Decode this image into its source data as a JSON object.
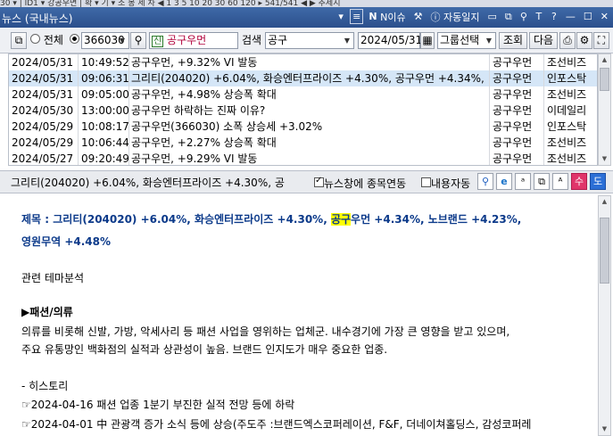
{
  "top_strip": {
    "text": "30 ▾  |  ID1 ▾  강공우면  |  확 ▾  기 ▾  조  봉  세  차  ◀  1  3  5  10 20 30 60 120  ▸   541/541  ◀  ▶  추세지"
  },
  "window": {
    "title": "뉴스 (국내뉴스)",
    "controls": {
      "n_issue_label": "N이슈",
      "auto_log_label": "자동일지"
    }
  },
  "toolbar": {
    "all_label": "전체",
    "stock_code": "366030",
    "stock_name": "공구우먼",
    "search_label": "검색",
    "search_value": "공구",
    "date": "2024/05/31",
    "group_select": "그룹선택",
    "query_button": "조회",
    "next_button": "다음"
  },
  "news": {
    "rows": [
      {
        "date": "2024/05/31",
        "time": "10:49:52",
        "title": "공구우먼, +9.32% VI 발동",
        "code": "공구우먼",
        "source": "조선비즈",
        "selected": false
      },
      {
        "date": "2024/05/31",
        "time": "09:06:31",
        "title": "그리티(204020) +6.04%, 화승엔터프라이즈 +4.30%, 공구우먼 +4.34%,",
        "code": "공구우먼",
        "source": "인포스탁",
        "selected": true
      },
      {
        "date": "2024/05/31",
        "time": "09:05:00",
        "title": "공구우먼, +4.98% 상승폭 확대",
        "code": "공구우먼",
        "source": "조선비즈",
        "selected": false
      },
      {
        "date": "2024/05/30",
        "time": "13:00:00",
        "title": "공구우먼 하락하는 진짜 이유?",
        "code": "공구우먼",
        "source": "이데일리",
        "selected": false
      },
      {
        "date": "2024/05/29",
        "time": "10:08:17",
        "title": "공구우먼(366030) 소폭 상승세 +3.02%",
        "code": "공구우먼",
        "source": "인포스탁",
        "selected": false
      },
      {
        "date": "2024/05/29",
        "time": "10:06:44",
        "title": "공구우먼, +2.27% 상승폭 확대",
        "code": "공구우먼",
        "source": "조선비즈",
        "selected": false
      },
      {
        "date": "2024/05/27",
        "time": "09:20:49",
        "title": "공구우먼, +9.29% VI 발동",
        "code": "공구우먼",
        "source": "조선비즈",
        "selected": false
      }
    ]
  },
  "detail": {
    "title": "그리티(204020)  +6.04%, 화승엔터프라이즈 +4.30%, 공",
    "link_label": "뉴스창에 종목연동",
    "content_label": "내용자동",
    "headline_prefix": "제목 : 그리티(204020) +6.04%, 화승엔터프라이즈 +4.30%, ",
    "headline_highlight": "공구",
    "headline_suffix": "우먼 +4.34%, 노브랜드 +4.23%,",
    "headline_line2": "영원무역 +4.48%",
    "related": "관련 테마분석",
    "theme_title": "▶패션/의류",
    "theme_desc1": "의류를 비롯해 신발, 가방, 악세사리 등 패션 사업을 영위하는 업체군. 내수경기에 가장 큰 영향을 받고 있으며,",
    "theme_desc2": "주요 유통망인 백화점의 실적과 상관성이 높음. 브랜드 인지도가 매우 중요한 업종.",
    "history_title": "- 히스토리",
    "history1": "☞2024-04-16 패션 업종 1분기 부진한 실적 전망 등에 하락",
    "history2": "☞2024-04-01 中 관광객 증가 소식 등에 상승(주도주 :브랜드엑스코퍼레이션, F&F, 더네이쳐홀딩스, 감성코퍼레"
  }
}
